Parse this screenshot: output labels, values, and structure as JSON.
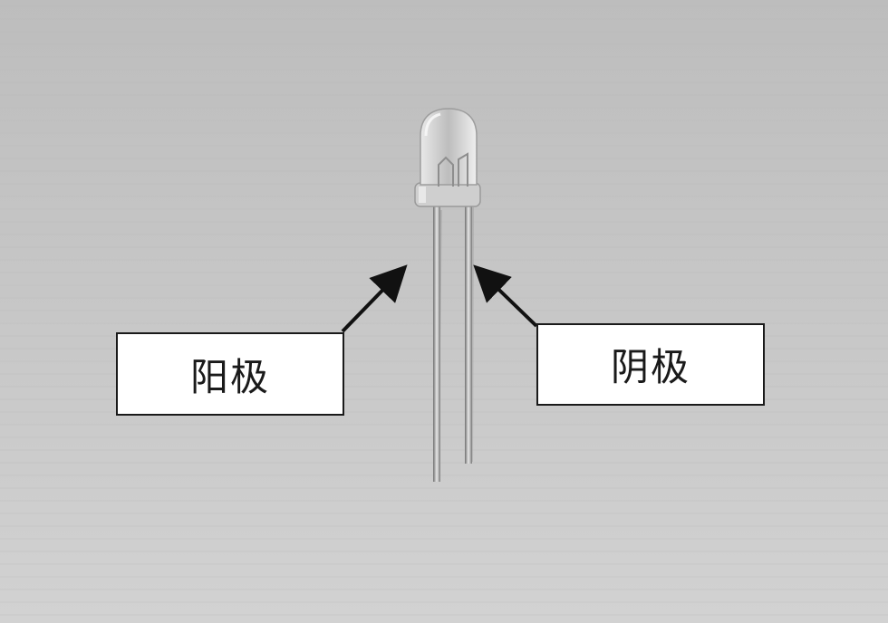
{
  "labels": {
    "anode": "阳极",
    "cathode": "阴极"
  },
  "colors": {
    "background": "#c6c6c6",
    "label_fill": "#ffffff",
    "label_border": "#1a1a1a",
    "arrow": "#111111"
  }
}
